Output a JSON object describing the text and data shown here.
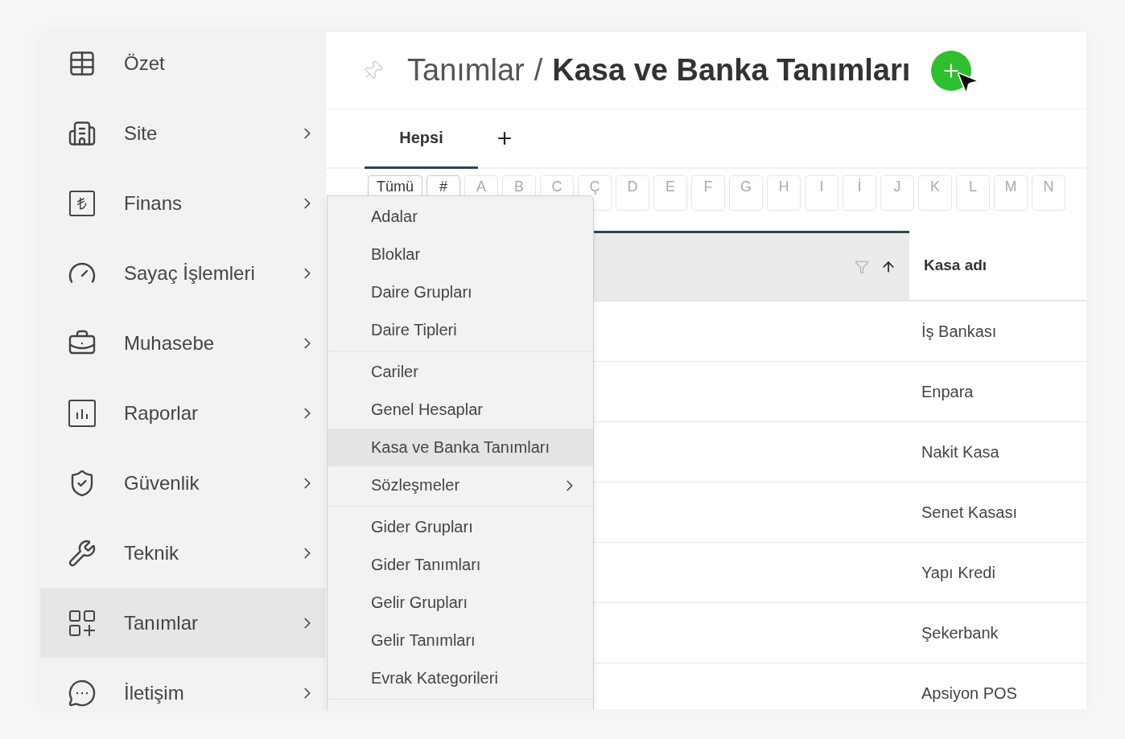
{
  "sidebar": {
    "items": [
      {
        "label": "Özet",
        "has_submenu": false,
        "selected": false
      },
      {
        "label": "Site",
        "has_submenu": true,
        "selected": false
      },
      {
        "label": "Finans",
        "has_submenu": true,
        "selected": false
      },
      {
        "label": "Sayaç İşlemleri",
        "has_submenu": true,
        "selected": false
      },
      {
        "label": "Muhasebe",
        "has_submenu": true,
        "selected": false
      },
      {
        "label": "Raporlar",
        "has_submenu": true,
        "selected": false
      },
      {
        "label": "Güvenlik",
        "has_submenu": true,
        "selected": false
      },
      {
        "label": "Teknik",
        "has_submenu": true,
        "selected": false
      },
      {
        "label": "Tanımlar",
        "has_submenu": true,
        "selected": true
      },
      {
        "label": "İletişim",
        "has_submenu": true,
        "selected": false
      }
    ]
  },
  "header": {
    "breadcrumb": "Tanımlar",
    "separator": "/",
    "title": "Kasa ve Banka Tanımları"
  },
  "tabs": [
    {
      "label": "Hepsi",
      "selected": true
    }
  ],
  "letter_filter": [
    {
      "label": "Tümü",
      "disabled": false
    },
    {
      "label": "#",
      "disabled": false
    },
    {
      "label": "A",
      "disabled": true
    },
    {
      "label": "B",
      "disabled": true
    },
    {
      "label": "C",
      "disabled": true
    },
    {
      "label": "Ç",
      "disabled": true
    },
    {
      "label": "D",
      "disabled": true
    },
    {
      "label": "E",
      "disabled": true
    },
    {
      "label": "F",
      "disabled": true
    },
    {
      "label": "G",
      "disabled": true
    },
    {
      "label": "H",
      "disabled": true
    },
    {
      "label": "I",
      "disabled": true
    },
    {
      "label": "İ",
      "disabled": true
    },
    {
      "label": "J",
      "disabled": true
    },
    {
      "label": "K",
      "disabled": true
    },
    {
      "label": "L",
      "disabled": true
    },
    {
      "label": "M",
      "disabled": true
    },
    {
      "label": "N",
      "disabled": true
    }
  ],
  "table": {
    "column_2": "Kasa adı",
    "rows": [
      "İş Bankası",
      "Enpara",
      "Nakit Kasa",
      "Senet Kasası",
      "Yapı Kredi",
      "Şekerbank",
      "Apsiyon POS"
    ]
  },
  "menu": {
    "groups": [
      [
        {
          "label": "Adalar",
          "selected": false,
          "has_submenu": false
        },
        {
          "label": "Bloklar",
          "selected": false,
          "has_submenu": false
        },
        {
          "label": "Daire Grupları",
          "selected": false,
          "has_submenu": false
        },
        {
          "label": "Daire Tipleri",
          "selected": false,
          "has_submenu": false
        }
      ],
      [
        {
          "label": "Cariler",
          "selected": false,
          "has_submenu": false
        },
        {
          "label": "Genel Hesaplar",
          "selected": false,
          "has_submenu": false
        },
        {
          "label": "Kasa ve Banka Tanımları",
          "selected": true,
          "has_submenu": false
        },
        {
          "label": "Sözleşmeler",
          "selected": false,
          "has_submenu": true
        }
      ],
      [
        {
          "label": "Gider Grupları",
          "selected": false,
          "has_submenu": false
        },
        {
          "label": "Gider Tanımları",
          "selected": false,
          "has_submenu": false
        },
        {
          "label": "Gelir Grupları",
          "selected": false,
          "has_submenu": false
        },
        {
          "label": "Gelir Tanımları",
          "selected": false,
          "has_submenu": false
        },
        {
          "label": "Evrak Kategorileri",
          "selected": false,
          "has_submenu": false
        }
      ]
    ]
  }
}
